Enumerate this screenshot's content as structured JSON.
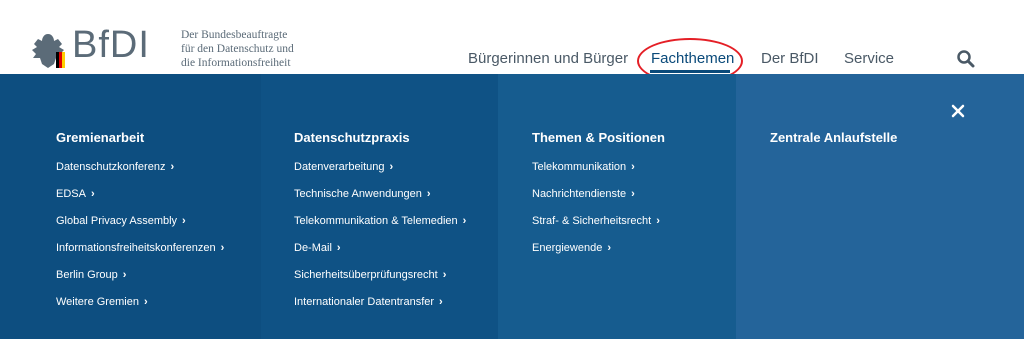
{
  "brand": {
    "logo_text": "BfDI",
    "tagline": [
      "Der Bundesbeauftragte",
      "für den Datenschutz und",
      "die Informationsfreiheit"
    ]
  },
  "nav": {
    "items": [
      {
        "label": "Bürgerinnen und Bürger"
      },
      {
        "label": "Fachthemen",
        "active": true
      },
      {
        "label": "Der BfDI"
      },
      {
        "label": "Service"
      }
    ]
  },
  "colors": {
    "nav_active": "#0a4a7a",
    "highlight": "#e41f26",
    "col1": "#0d4e80",
    "col2": "#0f5285",
    "col3": "#165c8f",
    "col4": "#24649a"
  },
  "icons": {
    "search": "search-icon",
    "close": "close-icon"
  },
  "menu": {
    "columns": [
      {
        "title": "Gremienarbeit",
        "links": [
          "Datenschutzkonferenz",
          "EDSA",
          "Global Privacy Assembly",
          "Informationsfreiheitskonferenzen",
          "Berlin Group",
          "Weitere Gremien"
        ]
      },
      {
        "title": "Datenschutzpraxis",
        "links": [
          "Datenverarbeitung",
          "Technische Anwendungen",
          "Telekommunikation & Telemedien",
          "De-Mail",
          "Sicherheitsüberprüfungsrecht",
          "Internationaler Datentransfer"
        ]
      },
      {
        "title": "Themen & Positionen",
        "links": [
          "Telekommunikation",
          "Nachrichtendienste",
          "Straf- & Sicherheitsrecht",
          "Energiewende"
        ]
      },
      {
        "title": "Zentrale Anlaufstelle",
        "links": []
      }
    ]
  }
}
